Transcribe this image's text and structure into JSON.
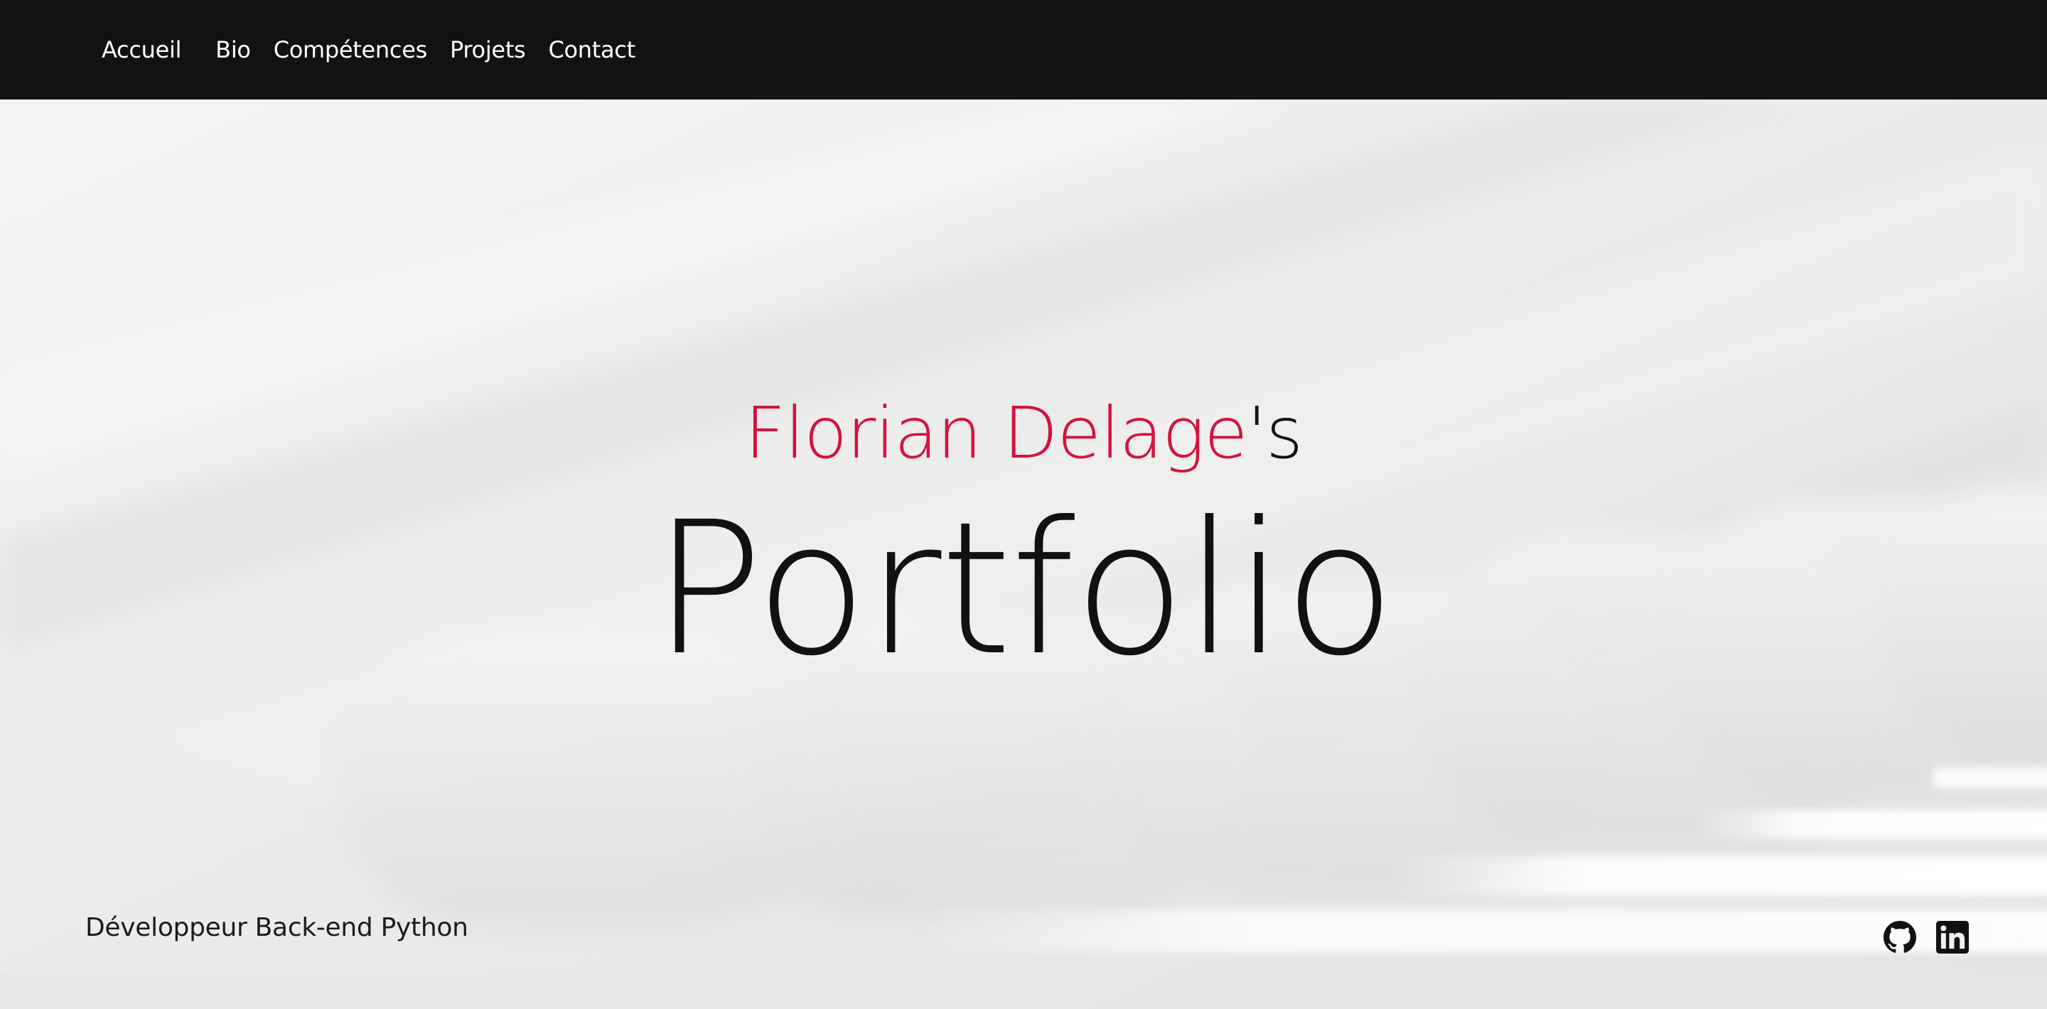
{
  "nav": {
    "items": [
      {
        "label": "Accueil"
      },
      {
        "label": "Bio"
      },
      {
        "label": "Compétences"
      },
      {
        "label": "Projets"
      },
      {
        "label": "Contact"
      }
    ]
  },
  "hero": {
    "owner_name": "Florian Delage",
    "owner_suffix": "'s",
    "title": "Portfolio",
    "subtitle": "Développeur Back-end Python"
  },
  "socials": [
    {
      "icon": "github-icon"
    },
    {
      "icon": "linkedin-icon"
    }
  ],
  "colors": {
    "accent": "#d4123e",
    "navbar": "#121212",
    "text": "#111111"
  }
}
